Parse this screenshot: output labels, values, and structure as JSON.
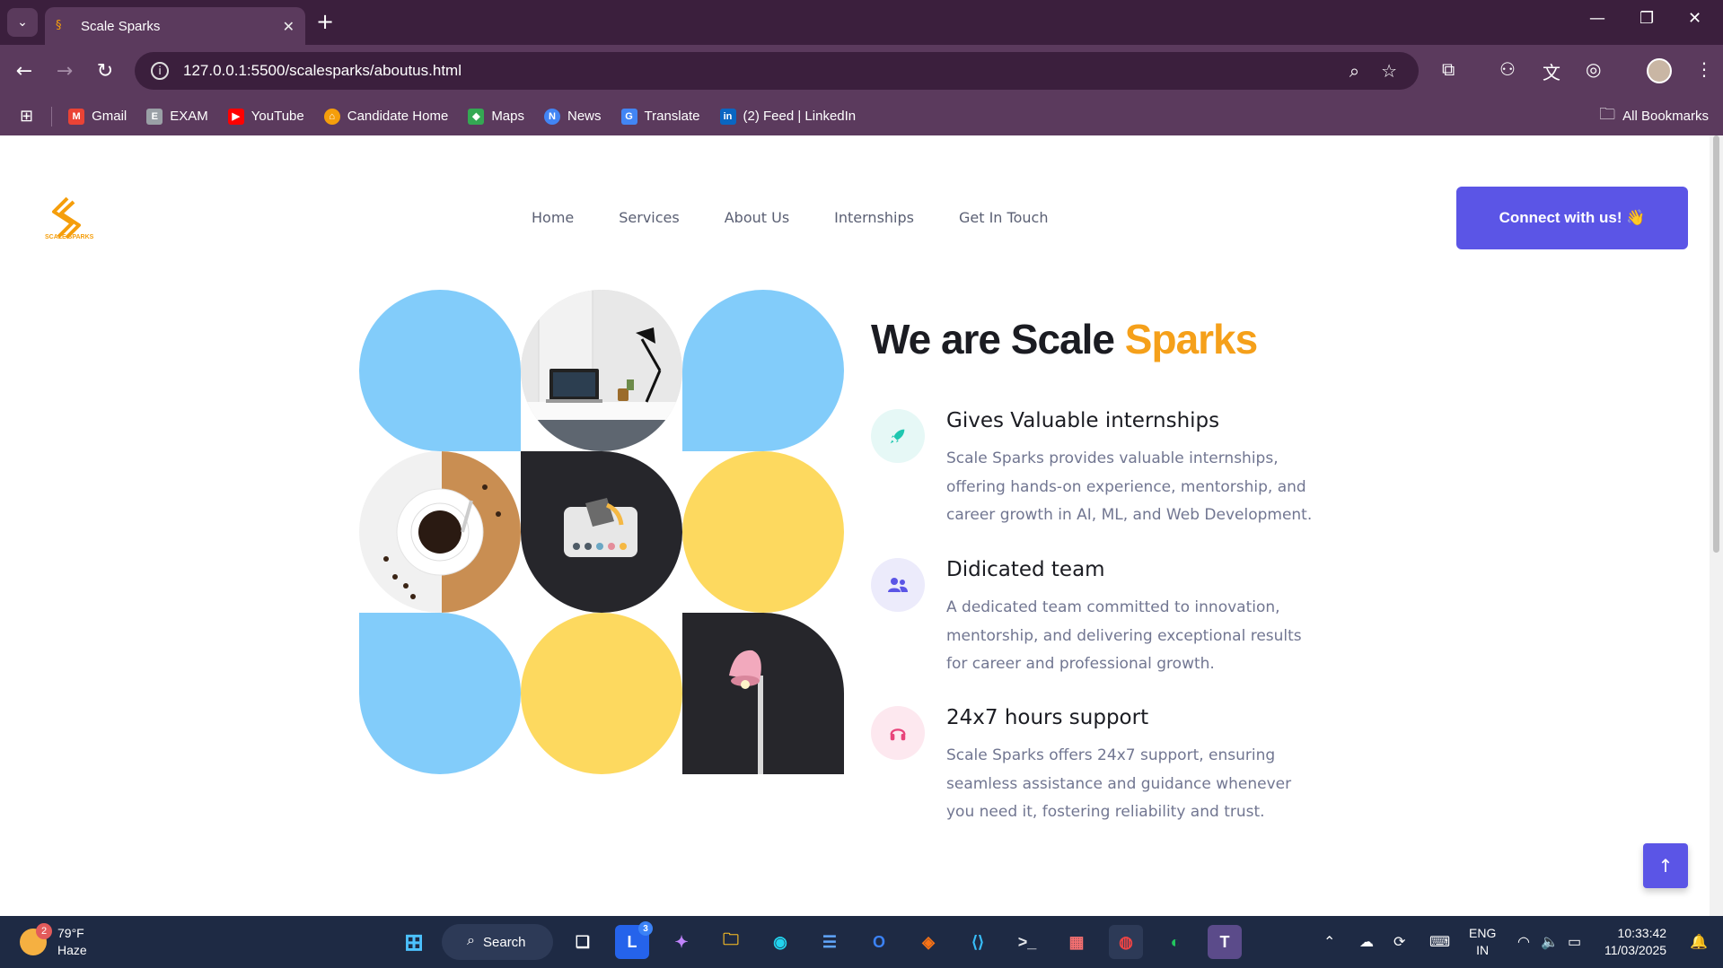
{
  "browser": {
    "tab_title": "Scale Sparks",
    "url": "127.0.0.1:5500/scalesparks/aboutus.html",
    "bookmarks": [
      {
        "label": "Gmail",
        "icon": "gmail-icon",
        "color": "#ea4335"
      },
      {
        "label": "EXAM",
        "icon": "exam-icon",
        "color": "#9aa0a6"
      },
      {
        "label": "YouTube",
        "icon": "youtube-icon",
        "color": "#ff0000"
      },
      {
        "label": "Candidate Home",
        "icon": "candidate-home-icon",
        "color": "#f59e0b"
      },
      {
        "label": "Maps",
        "icon": "maps-icon",
        "color": "#34a853"
      },
      {
        "label": "News",
        "icon": "news-icon",
        "color": "#4285f4"
      },
      {
        "label": "Translate",
        "icon": "translate-icon",
        "color": "#4285f4"
      },
      {
        "label": "(2) Feed | LinkedIn",
        "icon": "linkedin-icon",
        "color": "#0a66c2"
      }
    ],
    "all_bookmarks_label": "All Bookmarks"
  },
  "site": {
    "logo_text": "SCALE SPARKS",
    "nav": [
      "Home",
      "Services",
      "About Us",
      "Internships",
      "Get In Touch"
    ],
    "cta_label": "Connect with us! 👋",
    "heading_main": "We are Scale ",
    "heading_accent": "Sparks",
    "accent_color": "#f5a01a",
    "brand_color": "#5b55e6",
    "features": [
      {
        "title": "Gives Valuable internships",
        "text": "Scale Sparks provides valuable internships, offering hands-on experience, mentorship, and career growth in AI, ML, and Web Development.",
        "icon": "rocket-icon",
        "badge_color": "#e6f8f6",
        "icon_color": "#1fc7b0"
      },
      {
        "title": "Didicated team",
        "text": "A dedicated team committed to innovation, mentorship, and delivering exceptional results for career and professional growth.",
        "icon": "users-icon",
        "badge_color": "#ecebfb",
        "icon_color": "#5b55e6"
      },
      {
        "title": "24x7 hours support",
        "text": "Scale Sparks offers 24x7 support, ensuring seamless assistance and guidance whenever you need it, fostering reliability and trust.",
        "icon": "headphones-icon",
        "badge_color": "#fde8ef",
        "icon_color": "#e8437a"
      }
    ]
  },
  "taskbar": {
    "weather_temp": "79°F",
    "weather_desc": "Haze",
    "weather_badge": "2",
    "search_label": "Search",
    "lang_line1": "ENG",
    "lang_line2": "IN",
    "time": "10:33:42",
    "date": "11/03/2025",
    "lens_badge": "3"
  }
}
